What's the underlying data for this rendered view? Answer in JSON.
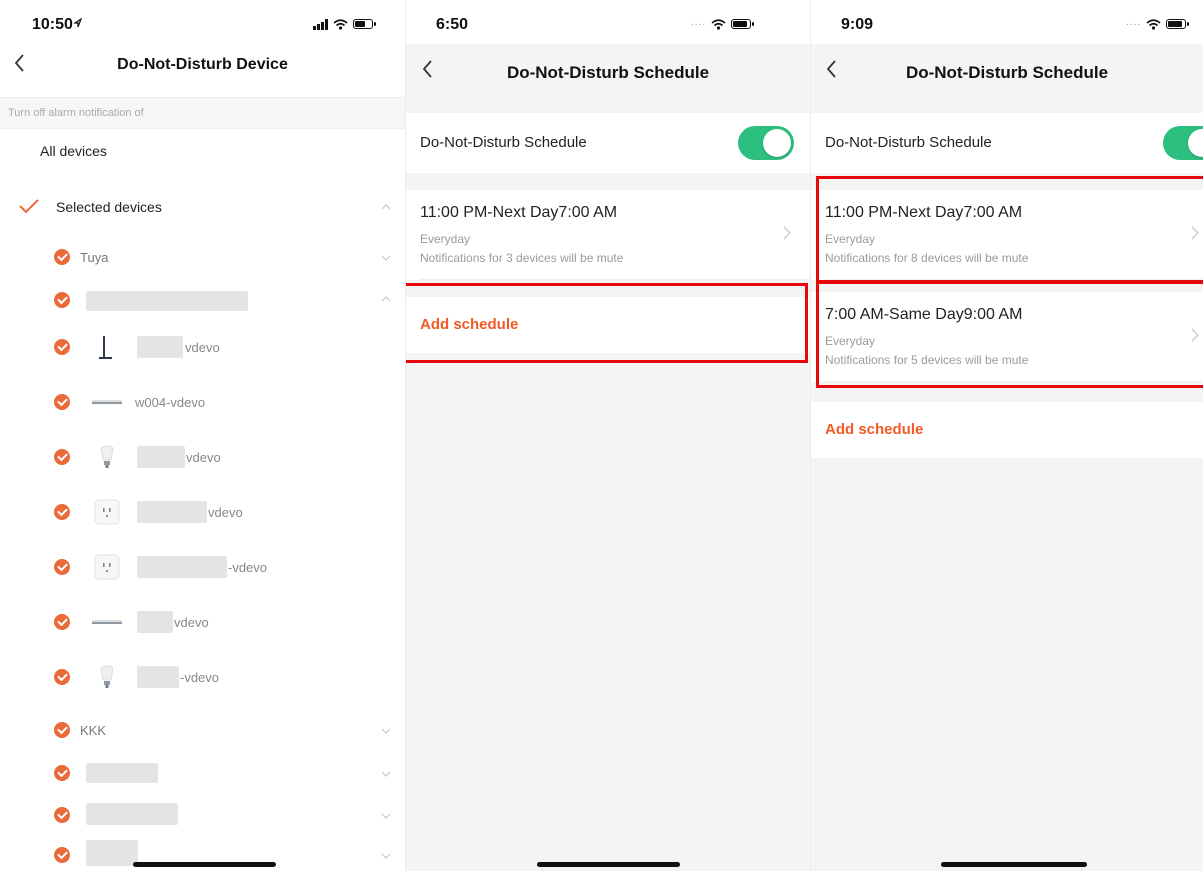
{
  "colors": {
    "accent": "#f05b25",
    "check_orange": "#ea6a3a",
    "toggle_on": "#2dbf80",
    "highlight_red": "#e8080c"
  },
  "screen1": {
    "status_time": "10:50",
    "title": "Do-Not-Disturb Device",
    "section_hint": "Turn off alarm notification of",
    "all_devices_label": "All devices",
    "selected_devices_label": "Selected devices",
    "groups": [
      {
        "label": "Tuya",
        "expanded": false
      },
      {
        "label": "",
        "expanded": true
      },
      {
        "label": "KKK",
        "expanded": false
      }
    ],
    "devices": [
      {
        "label": "vdevo",
        "icon": "floor-lamp-icon"
      },
      {
        "label": "w004-vdevo",
        "icon": "light-strip-icon"
      },
      {
        "label": "vdevo",
        "icon": "bulb-icon"
      },
      {
        "label": "vdevo",
        "icon": "socket-icon"
      },
      {
        "label": "-vdevo",
        "icon": "socket-icon"
      },
      {
        "label": "vdevo",
        "icon": "light-strip-icon"
      },
      {
        "label": "-vdevo",
        "icon": "bulb-icon"
      }
    ]
  },
  "screen2": {
    "status_time": "6:50",
    "title": "Do-Not-Disturb Schedule",
    "toggle_label": "Do-Not-Disturb Schedule",
    "toggle_on": true,
    "schedules": [
      {
        "time": "11:00 PM-Next Day7:00 AM",
        "repeat": "Everyday",
        "note": "Notifications for 3 devices will be mute"
      }
    ],
    "add_label": "Add schedule"
  },
  "screen3": {
    "status_time": "9:09",
    "title": "Do-Not-Disturb Schedule",
    "toggle_label": "Do-Not-Disturb Schedule",
    "toggle_on": true,
    "schedules": [
      {
        "time": "11:00 PM-Next Day7:00 AM",
        "repeat": "Everyday",
        "note": "Notifications for 8 devices will be mute"
      },
      {
        "time": "7:00 AM-Same Day9:00 AM",
        "repeat": "Everyday",
        "note": "Notifications for 5 devices will be mute"
      }
    ],
    "add_label": "Add schedule"
  }
}
